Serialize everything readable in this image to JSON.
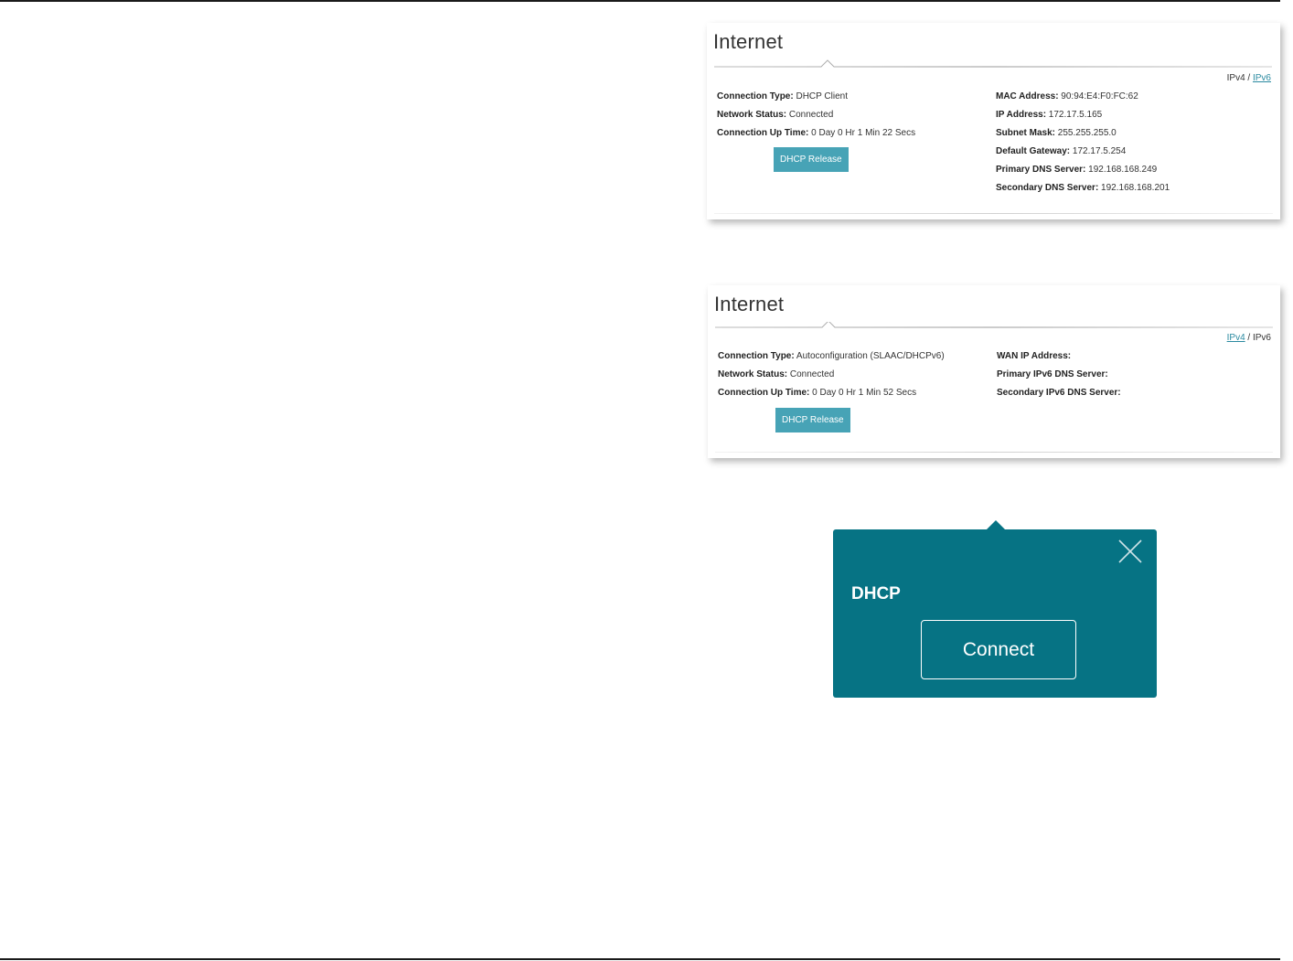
{
  "ipv4_panel": {
    "title": "Internet",
    "version_switch": {
      "current": "IPv4",
      "separator": " / ",
      "other": "IPv6"
    },
    "left": [
      {
        "label": "Connection Type:",
        "value": " DHCP Client"
      },
      {
        "label": "Network Status:",
        "value": " Connected"
      },
      {
        "label": "Connection Up Time:",
        "value": " 0 Day 0 Hr 1 Min 22 Secs"
      }
    ],
    "right": [
      {
        "label": "MAC Address:",
        "value": " 90:94:E4:F0:FC:62"
      },
      {
        "label": "IP Address:",
        "value": " 172.17.5.165"
      },
      {
        "label": "Subnet Mask:",
        "value": " 255.255.255.0"
      },
      {
        "label": "Default Gateway:",
        "value": " 172.17.5.254"
      },
      {
        "label": "Primary DNS Server:",
        "value": " 192.168.168.249"
      },
      {
        "label": "Secondary DNS Server:",
        "value": " 192.168.168.201"
      }
    ],
    "release_label": "DHCP Release"
  },
  "ipv6_panel": {
    "title": "Internet",
    "version_switch": {
      "other": "IPv4",
      "separator": " / ",
      "current": "IPv6"
    },
    "left": [
      {
        "label": "Connection Type:",
        "value": " Autoconfiguration (SLAAC/DHCPv6)"
      },
      {
        "label": "Network Status:",
        "value": " Connected"
      },
      {
        "label": "Connection Up Time:",
        "value": " 0 Day 0 Hr 1 Min 52 Secs"
      }
    ],
    "right": [
      {
        "label": "WAN IP Address:",
        "value": ""
      },
      {
        "label": "Primary IPv6 DNS Server:",
        "value": ""
      },
      {
        "label": "Secondary IPv6 DNS Server:",
        "value": ""
      }
    ],
    "release_label": "DHCP Release"
  },
  "popup": {
    "title": "DHCP",
    "connect_label": "Connect",
    "close_icon": "close-icon"
  },
  "colors": {
    "popup_bg": "#067384",
    "button_bg": "#47a3b6",
    "link": "#2a8aa0"
  }
}
